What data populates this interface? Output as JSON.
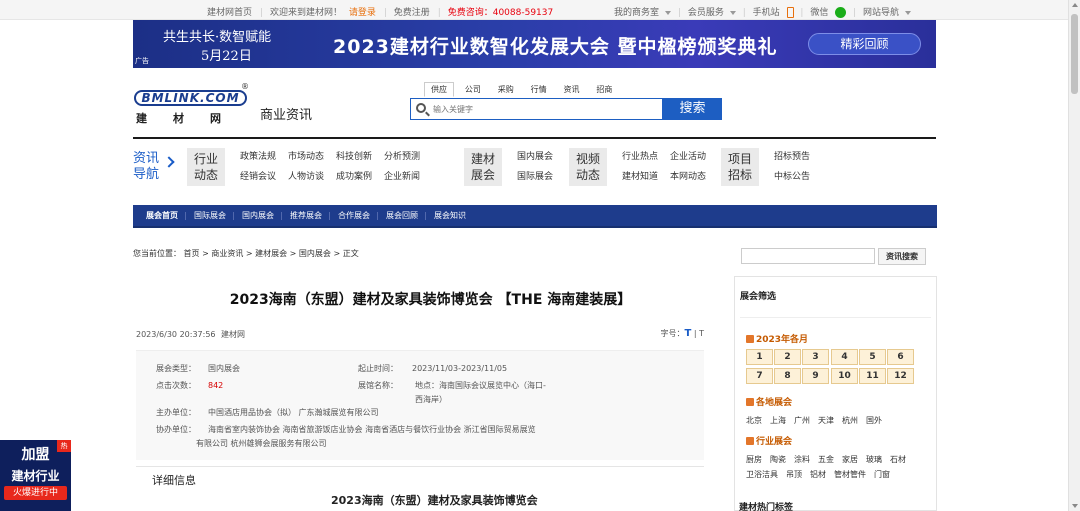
{
  "topbar": {
    "home": "建材网首页",
    "welcome": "欢迎来到建材网！",
    "login": "请登录",
    "register": "免费注册",
    "hotline_label": "免费咨询：",
    "hotline": "40088-59137",
    "my_business": "我的商务室",
    "member_service": "会员服务",
    "mobile": "手机站",
    "wechat": "微信",
    "site_nav": "网站导航"
  },
  "banner": {
    "line1": "共生共长·数智赋能",
    "line2": "5月22日",
    "headline": "2023建材行业数智化发展大会 暨中楹榜颁奖典礼",
    "cta": "精彩回顾",
    "ad_tag": "广告"
  },
  "header": {
    "logo_text": "BMLINK.COM",
    "logo_reg": "®",
    "logo_cn": "建材网",
    "section": "商业资讯",
    "tabs": [
      "供应",
      "公司",
      "采购",
      "行情",
      "资讯",
      "招商"
    ],
    "search_placeholder": "输入关键字",
    "search_button": "搜索"
  },
  "catnav": {
    "label_line1": "资讯",
    "label_line2": "导航",
    "blocks": [
      {
        "line1": "行业",
        "line2": "动态",
        "links": [
          [
            "政策法规",
            "市场动态",
            "科技创新",
            "分析预测"
          ],
          [
            "经销会议",
            "人物访谈",
            "成功案例",
            "企业新闻"
          ]
        ]
      },
      {
        "line1": "建材",
        "line2": "展会",
        "links": [
          [
            "国内展会"
          ],
          [
            "国际展会"
          ]
        ]
      },
      {
        "line1": "视频",
        "line2": "动态",
        "links": [
          [
            "行业热点",
            "企业活动"
          ],
          [
            "建材知道",
            "本网动态"
          ]
        ]
      },
      {
        "line1": "项目",
        "line2": "招标",
        "links": [
          [
            "招标预告"
          ],
          [
            "中标公告"
          ]
        ]
      }
    ]
  },
  "bluenav": [
    "展会首页",
    "国际展会",
    "国内展会",
    "推荐展会",
    "合作展会",
    "展会回顾",
    "展会知识"
  ],
  "breadcrumb": "您当前位置： 首页 > 商业资讯 > 建材展会 > 国内展会 > 正文",
  "side_search_button": "资讯搜索",
  "article": {
    "title": "2023海南（东盟）建材及家具装饰博览会 【THE 海南建装展】",
    "date": "2023/6/30 20:37:56",
    "source": "建材网",
    "font_size_label": "字号：",
    "font_big": "T",
    "font_small": "T",
    "info": {
      "type_label": "展会类型：",
      "type": "国内展会",
      "clicks_label": "点击次数：",
      "clicks": "842",
      "period_label": "起止时间：",
      "period": "2023/11/03-2023/11/05",
      "venue_label": "展馆名称：",
      "venue": "地点：海南国际会议展览中心（海口-西海岸）",
      "host_label": "主办单位：",
      "host": "中国酒店用品协会（拟）  广东瀚城展览有限公司",
      "co_label": "协办单位：",
      "co_line1": "海南省室内装饰协会 海南省旅游饭店业协会 海南省酒店与餐饮行业协会 浙江省国际贸易展览",
      "co_line2": "有限公司 杭州雄狮会展服务有限公司"
    },
    "detail_heading": "详细信息",
    "detail_subtitle": "2023海南（东盟）建材及家具装饰博览会"
  },
  "sidebar": {
    "title": "展会筛选",
    "month_heading": "2023年各月",
    "months": [
      "1",
      "2",
      "3",
      "4",
      "5",
      "6",
      "7",
      "8",
      "9",
      "10",
      "11",
      "12"
    ],
    "region_heading": "各地展会",
    "regions": [
      "北京",
      "上海",
      "广州",
      "天津",
      "杭州",
      "国外"
    ],
    "industry_heading": "行业展会",
    "industries_line1": [
      "厨房",
      "陶瓷",
      "涂料",
      "五金",
      "家居",
      "玻璃",
      "石材"
    ],
    "industries_line2": [
      "卫浴洁具",
      "吊顶",
      "铝材",
      "管材管件",
      "门窗"
    ],
    "hot_tags": "建材热门标签"
  },
  "float_ad": {
    "line1": "加盟",
    "line2": "建材行业",
    "line3": "火爆进行中",
    "hot": "热"
  }
}
